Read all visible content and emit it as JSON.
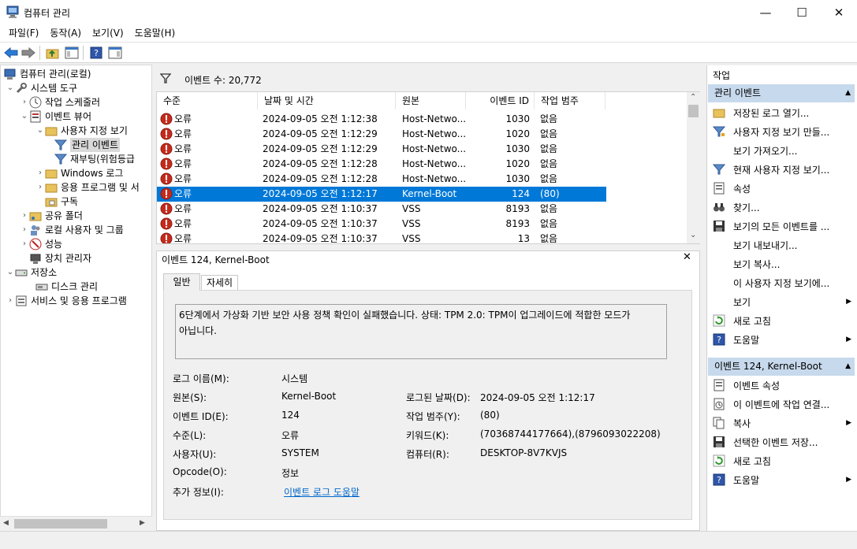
{
  "window": {
    "title": "컴퓨터 관리",
    "icon": "computer-management-icon",
    "minimize_glyph": "—",
    "maximize_glyph": "☐",
    "close_glyph": "✕"
  },
  "menu": [
    "파일(F)",
    "동작(A)",
    "보기(V)",
    "도움말(H)"
  ],
  "toolbar": {
    "icons": [
      "back-arrow-icon",
      "forward-arrow-icon",
      "up-folder-icon",
      "show-hide-tree-icon",
      "help-icon",
      "show-hide-action-pane-icon"
    ]
  },
  "tree": {
    "root": "컴퓨터 관리(로컬)",
    "system_tools": "시스템 도구",
    "task_scheduler": "작업 스케줄러",
    "event_viewer": "이벤트 뷰어",
    "custom_views": "사용자 지정 보기",
    "admin_events": "관리 이벤트",
    "reboot_view": "재부팅(위험등급",
    "windows_logs": "Windows 로그",
    "app_logs": "응용 프로그램 및 서",
    "subscriptions": "구독",
    "shared_folders": "공유 폴더",
    "local_users": "로컬 사용자 및 그룹",
    "performance": "성능",
    "device_manager": "장치 관리자",
    "storage": "저장소",
    "disk_management": "디스크 관리",
    "services_apps": "서비스 및 응용 프로그램"
  },
  "events": {
    "count_label": "이벤트 수: 20,772",
    "columns": [
      "수준",
      "날짜 및 시간",
      "원본",
      "이벤트 ID",
      "작업 범주"
    ],
    "rows": [
      {
        "level": "오류",
        "datetime": "2024-09-05 오전 1:12:38",
        "source": "Host-Netwo...",
        "id": "1030",
        "category": "없음",
        "icon": "error-icon"
      },
      {
        "level": "오류",
        "datetime": "2024-09-05 오전 1:12:29",
        "source": "Host-Netwo...",
        "id": "1020",
        "category": "없음",
        "icon": "error-icon"
      },
      {
        "level": "오류",
        "datetime": "2024-09-05 오전 1:12:29",
        "source": "Host-Netwo...",
        "id": "1030",
        "category": "없음",
        "icon": "error-icon"
      },
      {
        "level": "오류",
        "datetime": "2024-09-05 오전 1:12:28",
        "source": "Host-Netwo...",
        "id": "1020",
        "category": "없음",
        "icon": "error-icon"
      },
      {
        "level": "오류",
        "datetime": "2024-09-05 오전 1:12:28",
        "source": "Host-Netwo...",
        "id": "1030",
        "category": "없음",
        "icon": "error-icon"
      },
      {
        "level": "오류",
        "datetime": "2024-09-05 오전 1:12:17",
        "source": "Kernel-Boot",
        "id": "124",
        "category": "(80)",
        "icon": "error-icon",
        "selected": true
      },
      {
        "level": "오류",
        "datetime": "2024-09-05 오전 1:10:37",
        "source": "VSS",
        "id": "8193",
        "category": "없음",
        "icon": "error-icon"
      },
      {
        "level": "오류",
        "datetime": "2024-09-05 오전 1:10:37",
        "source": "VSS",
        "id": "8193",
        "category": "없음",
        "icon": "error-icon"
      },
      {
        "level": "오류",
        "datetime": "2024-09-05 오전 1:10:37",
        "source": "VSS",
        "id": "13",
        "category": "없음",
        "icon": "error-icon"
      }
    ]
  },
  "detail": {
    "title": "이벤트 124, Kernel-Boot",
    "close_glyph": "✕",
    "tabs": [
      "일반",
      "자세히"
    ],
    "description_line1": "6단계에서 가상화 기반 보안 사용 정책 확인이 실패했습니다. 상태: TPM 2.0: TPM이 업그레이드에 적합한 모드가",
    "description_line2": "아닙니다.",
    "log_name_label": "로그 이름(M):",
    "log_name": "시스템",
    "source_label": "원본(S):",
    "source": "Kernel-Boot",
    "logged_label": "로그된 날짜(D):",
    "logged": "2024-09-05 오전 1:12:17",
    "event_id_label": "이벤트 ID(E):",
    "event_id": "124",
    "category_label": "작업 범주(Y):",
    "category": "(80)",
    "level_label": "수준(L):",
    "level": "오류",
    "keywords_label": "키워드(K):",
    "keywords": "(70368744177664),(8796093022208)",
    "user_label": "사용자(U):",
    "user": "SYSTEM",
    "computer_label": "컴퓨터(R):",
    "computer": "DESKTOP-8V7KVJS",
    "opcode_label": "Opcode(O):",
    "opcode": "정보",
    "more_info_label": "추가 정보(I):",
    "more_info_link": "이벤트 로그 도움말"
  },
  "actions": {
    "title": "작업",
    "section1": "관리 이벤트",
    "section1_items": [
      {
        "label": "저장된 로그 열기...",
        "icon": "open-folder-icon"
      },
      {
        "label": "사용자 지정 보기 만들...",
        "icon": "filter-create-icon"
      },
      {
        "label": "보기 가져오기...",
        "icon": ""
      },
      {
        "label": "현재 사용자 지정 보기...",
        "icon": "filter-icon"
      },
      {
        "label": "속성",
        "icon": "properties-icon"
      },
      {
        "label": "찾기...",
        "icon": "binoculars-icon"
      },
      {
        "label": "보기의 모든 이벤트를 ...",
        "icon": "save-icon"
      },
      {
        "label": "보기 내보내기...",
        "icon": ""
      },
      {
        "label": "보기 복사...",
        "icon": ""
      },
      {
        "label": "이 사용자 지정 보기에...",
        "icon": ""
      },
      {
        "label": "보기",
        "icon": "",
        "submenu": true
      },
      {
        "label": "새로 고침",
        "icon": "refresh-icon"
      },
      {
        "label": "도움말",
        "icon": "help-icon",
        "submenu": true
      }
    ],
    "section2": "이벤트 124, Kernel-Boot",
    "section2_items": [
      {
        "label": "이벤트 속성",
        "icon": "event-properties-icon"
      },
      {
        "label": "이 이벤트에 작업 연결...",
        "icon": "attach-task-icon"
      },
      {
        "label": "복사",
        "icon": "copy-icon",
        "submenu": true
      },
      {
        "label": "선택한 이벤트 저장...",
        "icon": "save-icon"
      },
      {
        "label": "새로 고침",
        "icon": "refresh-icon"
      },
      {
        "label": "도움말",
        "icon": "help-icon",
        "submenu": true
      }
    ]
  }
}
